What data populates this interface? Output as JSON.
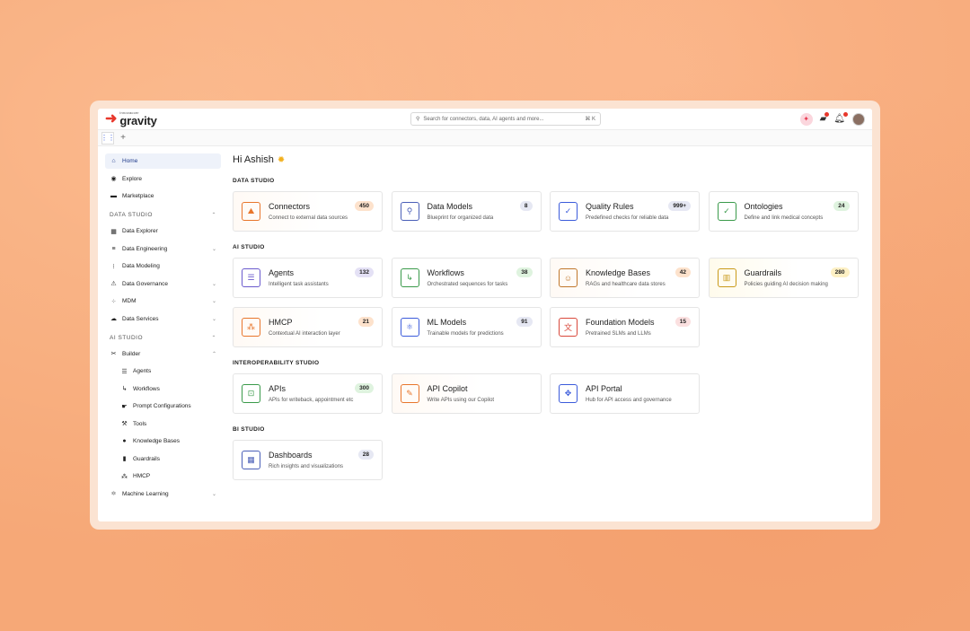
{
  "brand": {
    "tagline": "innovaccer",
    "name": "gravity"
  },
  "search": {
    "placeholder": "Search for connectors, data, AI agents and more...",
    "shortcut": "⌘ K"
  },
  "tabs": {
    "add": "+"
  },
  "greeting": "Hi Ashish",
  "sidebar": {
    "top": [
      {
        "label": "Home",
        "icon": "home-icon"
      },
      {
        "label": "Explore",
        "icon": "compass-icon"
      },
      {
        "label": "Marketplace",
        "icon": "store-icon"
      }
    ],
    "data_studio": {
      "title": "DATA STUDIO",
      "items": [
        {
          "label": "Data Explorer"
        },
        {
          "label": "Data Engineering"
        },
        {
          "label": "Data Modeling"
        },
        {
          "label": "Data Governance"
        },
        {
          "label": "MDM"
        },
        {
          "label": "Data Services"
        }
      ]
    },
    "ai_studio": {
      "title": "AI STUDIO",
      "builder": "Builder",
      "items": [
        {
          "label": "Agents"
        },
        {
          "label": "Workflows"
        },
        {
          "label": "Prompt Configurations"
        },
        {
          "label": "Tools"
        },
        {
          "label": "Knowledge Bases"
        },
        {
          "label": "Guardrails"
        },
        {
          "label": "HMCP"
        }
      ],
      "machine_learning": "Machine Learning"
    }
  },
  "sections": [
    {
      "title": "DATA STUDIO",
      "cards": [
        {
          "title": "Connectors",
          "desc": "Connect to external data sources",
          "badge": "450",
          "badge_color": "#fde2cc",
          "icon_color": "#e8762c",
          "icon": "⛰"
        },
        {
          "title": "Data Models",
          "desc": "Blueprint for organized data",
          "badge": "8",
          "badge_color": "#e6e8f3",
          "icon_color": "#4a5fb8",
          "icon": "⚲"
        },
        {
          "title": "Quality Rules",
          "desc": "Predefined checks for reliable data",
          "badge": "999+",
          "badge_color": "#e6e8f3",
          "icon_color": "#3b5bdb",
          "icon": "✓"
        },
        {
          "title": "Ontologies",
          "desc": "Define and link medical concepts",
          "badge": "24",
          "badge_color": "#dff3df",
          "icon_color": "#3a9a4a",
          "icon": "✓"
        }
      ]
    },
    {
      "title": "AI STUDIO",
      "cards": [
        {
          "title": "Agents",
          "desc": "Intelligent task assistants",
          "badge": "132",
          "badge_color": "#e4e1f5",
          "icon_color": "#6a5acd",
          "icon": "☰"
        },
        {
          "title": "Workflows",
          "desc": "Orchestrated sequences for tasks",
          "badge": "38",
          "badge_color": "#dff3df",
          "icon_color": "#3a9a4a",
          "icon": "↳"
        },
        {
          "title": "Knowledge Bases",
          "desc": "RAGs and healthcare data stores",
          "badge": "42",
          "badge_color": "#fde2cc",
          "icon_color": "#c0772c",
          "icon": "☺"
        },
        {
          "title": "Guardrails",
          "desc": "Policies guiding AI decision making",
          "badge": "280",
          "badge_color": "#fdf0c4",
          "icon_color": "#c99a1a",
          "icon": "▥"
        },
        {
          "title": "HMCP",
          "desc": "Contextual AI interaction layer",
          "badge": "21",
          "badge_color": "#fde2cc",
          "icon_color": "#e8762c",
          "icon": "⁂"
        },
        {
          "title": "ML Models",
          "desc": "Trainable models for predictions",
          "badge": "91",
          "badge_color": "#e6e8f3",
          "icon_color": "#3b5bdb",
          "icon": "⚛"
        },
        {
          "title": "Foundation Models",
          "desc": "Pretrained SLMs and LLMs",
          "badge": "15",
          "badge_color": "#fbe0e0",
          "icon_color": "#d9483b",
          "icon": "文"
        }
      ]
    },
    {
      "title": "INTEROPERABILITY STUDIO",
      "cards": [
        {
          "title": "APIs",
          "desc": "APIs for writeback, appointment etc",
          "badge": "300",
          "badge_color": "#dff3df",
          "icon_color": "#3a9a4a",
          "icon": "⊡"
        },
        {
          "title": "API Copilot",
          "desc": "Write APIs using our Copilot",
          "badge": "",
          "badge_color": "",
          "icon_color": "#e8762c",
          "icon": "✎"
        },
        {
          "title": "API Portal",
          "desc": "Hub for API access and governance",
          "badge": "",
          "badge_color": "",
          "icon_color": "#3b5bdb",
          "icon": "✥"
        }
      ]
    },
    {
      "title": "BI STUDIO",
      "cards": [
        {
          "title": "Dashboards",
          "desc": "Rich insights and visualizations",
          "badge": "28",
          "badge_color": "#e6e8f3",
          "icon_color": "#4a5fb8",
          "icon": "▦"
        }
      ]
    }
  ]
}
